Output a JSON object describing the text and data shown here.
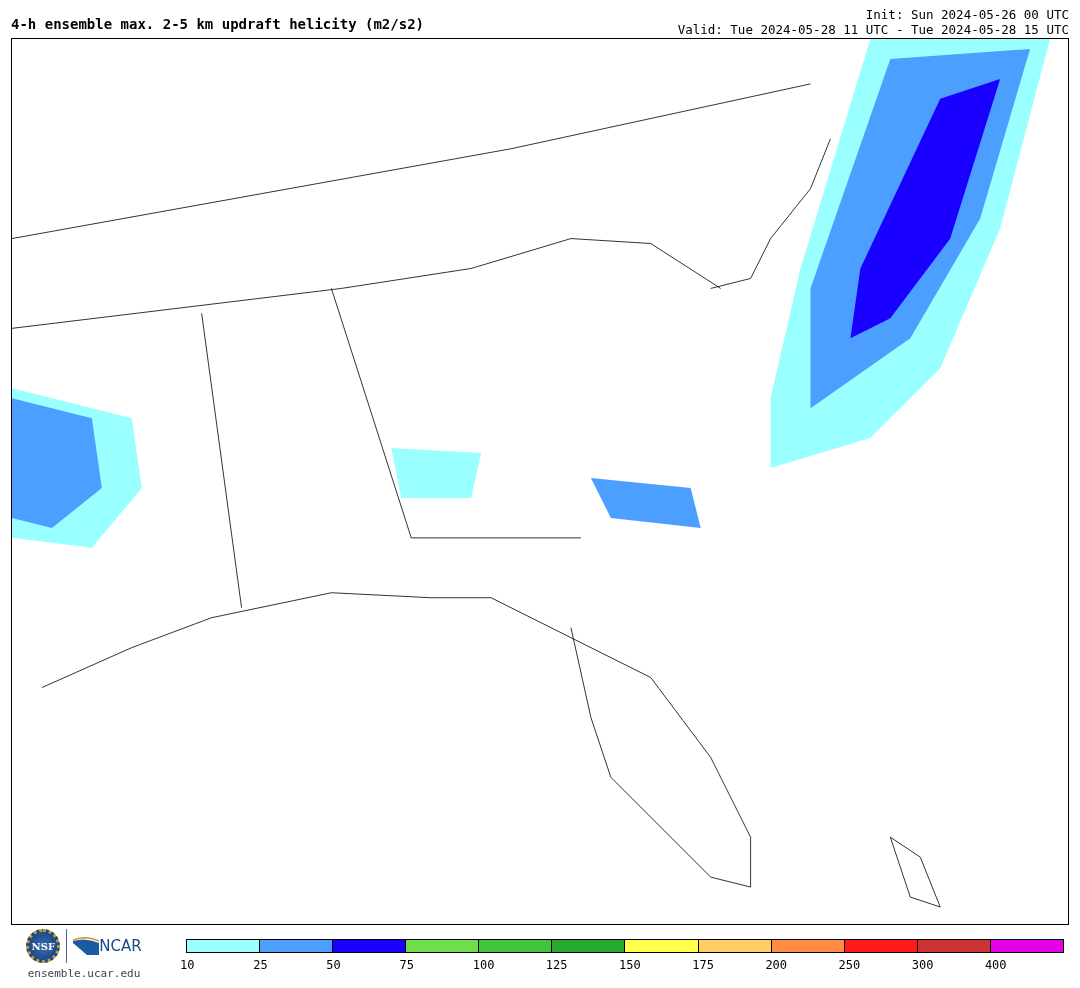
{
  "title": "4-h ensemble max. 2-5 km updraft helicity (m2/s2)",
  "init": "Init: Sun 2024-05-26 00 UTC",
  "valid": "Valid: Tue 2024-05-28 11 UTC - Tue 2024-05-28 15 UTC",
  "logos": {
    "nsf": "NSF",
    "ncar": "NCAR",
    "url": "ensemble.ucar.edu"
  },
  "legend": [
    {
      "label": "10",
      "color": "#99ffff"
    },
    {
      "label": "25",
      "color": "#4c9eff"
    },
    {
      "label": "50",
      "color": "#1a00ff"
    },
    {
      "label": "75",
      "color": "#6fdd4c"
    },
    {
      "label": "100",
      "color": "#44c43d"
    },
    {
      "label": "125",
      "color": "#26a831"
    },
    {
      "label": "150",
      "color": "#ffff4c"
    },
    {
      "label": "175",
      "color": "#ffcc66"
    },
    {
      "label": "200",
      "color": "#ff8c42"
    },
    {
      "label": "250",
      "color": "#ff1a1a"
    },
    {
      "label": "300",
      "color": "#cc3333"
    },
    {
      "label": "400",
      "color": "#e600e6"
    }
  ]
}
